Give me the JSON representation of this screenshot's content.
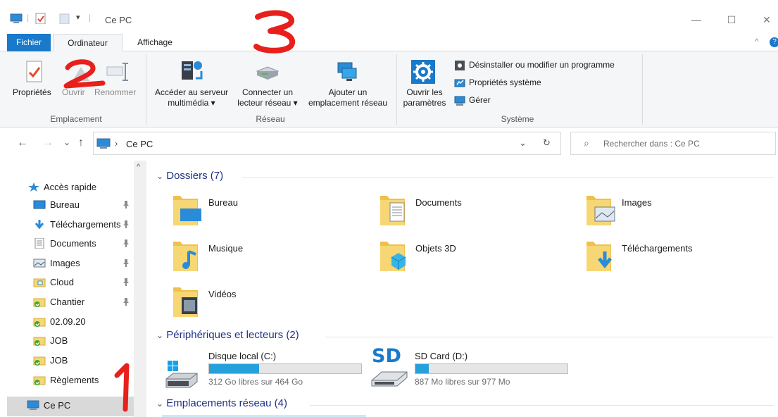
{
  "window": {
    "title": "Ce PC",
    "minimize": "—",
    "maximize": "☐",
    "close": "✕"
  },
  "ribbon": {
    "tabs": [
      "Fichier",
      "Ordinateur",
      "Affichage"
    ],
    "collapse": "^",
    "help": "?",
    "groups": {
      "emplacement": {
        "label": "Emplacement",
        "buttons": [
          "Propriétés",
          "Ouvrir",
          "Renommer"
        ]
      },
      "reseau": {
        "label": "Réseau",
        "media_l1": "Accéder au serveur",
        "media_l2": "multimédia ▾",
        "drive_l1": "Connecter un",
        "drive_l2": "lecteur réseau ▾",
        "loc_l1": "Ajouter un",
        "loc_l2": "emplacement réseau"
      },
      "systeme": {
        "label": "Système",
        "settings_l1": "Ouvrir les",
        "settings_l2": "paramètres",
        "uninstall": "Désinstaller ou modifier un programme",
        "sysprops": "Propriétés système",
        "manage": "Gérer"
      }
    }
  },
  "address": {
    "back": "←",
    "forward": "→",
    "recent": "⌄",
    "up": "↑",
    "sep": "›",
    "path": "Ce PC",
    "dropdown": "⌄",
    "refresh": "↻",
    "search_icon": "⌕",
    "search_placeholder": "Rechercher dans : Ce PC"
  },
  "nav": {
    "scroll_up": "^",
    "pin": "📌",
    "items": [
      {
        "label": "Accès rapide",
        "icon": "star-icon"
      },
      {
        "label": "Bureau",
        "icon": "desktop-icon",
        "pinned": true
      },
      {
        "label": "Téléchargements",
        "icon": "download-arrow-icon",
        "pinned": true
      },
      {
        "label": "Documents",
        "icon": "document-icon",
        "pinned": true
      },
      {
        "label": "Images",
        "icon": "picture-icon",
        "pinned": true
      },
      {
        "label": "Cloud",
        "icon": "folder-icon",
        "pinned": true
      },
      {
        "label": "Chantier",
        "icon": "synced-folder-icon",
        "pinned": true
      },
      {
        "label": "02.09.20",
        "icon": "synced-folder-icon"
      },
      {
        "label": "JOB",
        "icon": "synced-folder-icon"
      },
      {
        "label": "JOB",
        "icon": "synced-folder-icon"
      },
      {
        "label": "Règlements",
        "icon": "synced-folder-icon"
      },
      {
        "label": "Ce PC",
        "icon": "computer-icon",
        "selected": true
      }
    ]
  },
  "content": {
    "chevron": "⌄",
    "folders_header": "Dossiers (7)",
    "folders": [
      "Bureau",
      "Documents",
      "Images",
      "Musique",
      "Objets 3D",
      "Téléchargements",
      "Vidéos"
    ],
    "devices_header": "Périphériques et lecteurs (2)",
    "drives": [
      {
        "name": "Disque local (C:)",
        "free": "312 Go libres sur 464 Go",
        "used_fraction": 0.33
      },
      {
        "name": "SD Card (D:)",
        "free": "887 Mo libres sur 977 Mo",
        "used_fraction": 0.09,
        "logo": "SD"
      }
    ],
    "network_header": "Emplacements réseau (4)"
  },
  "annotations": [
    "1",
    "2",
    "3"
  ],
  "colors": {
    "accent": "#1979ca",
    "section_header": "#1e3287",
    "drive_fill": "#26a0da",
    "folder": "#f7d774",
    "annotation": "#e8201c"
  }
}
